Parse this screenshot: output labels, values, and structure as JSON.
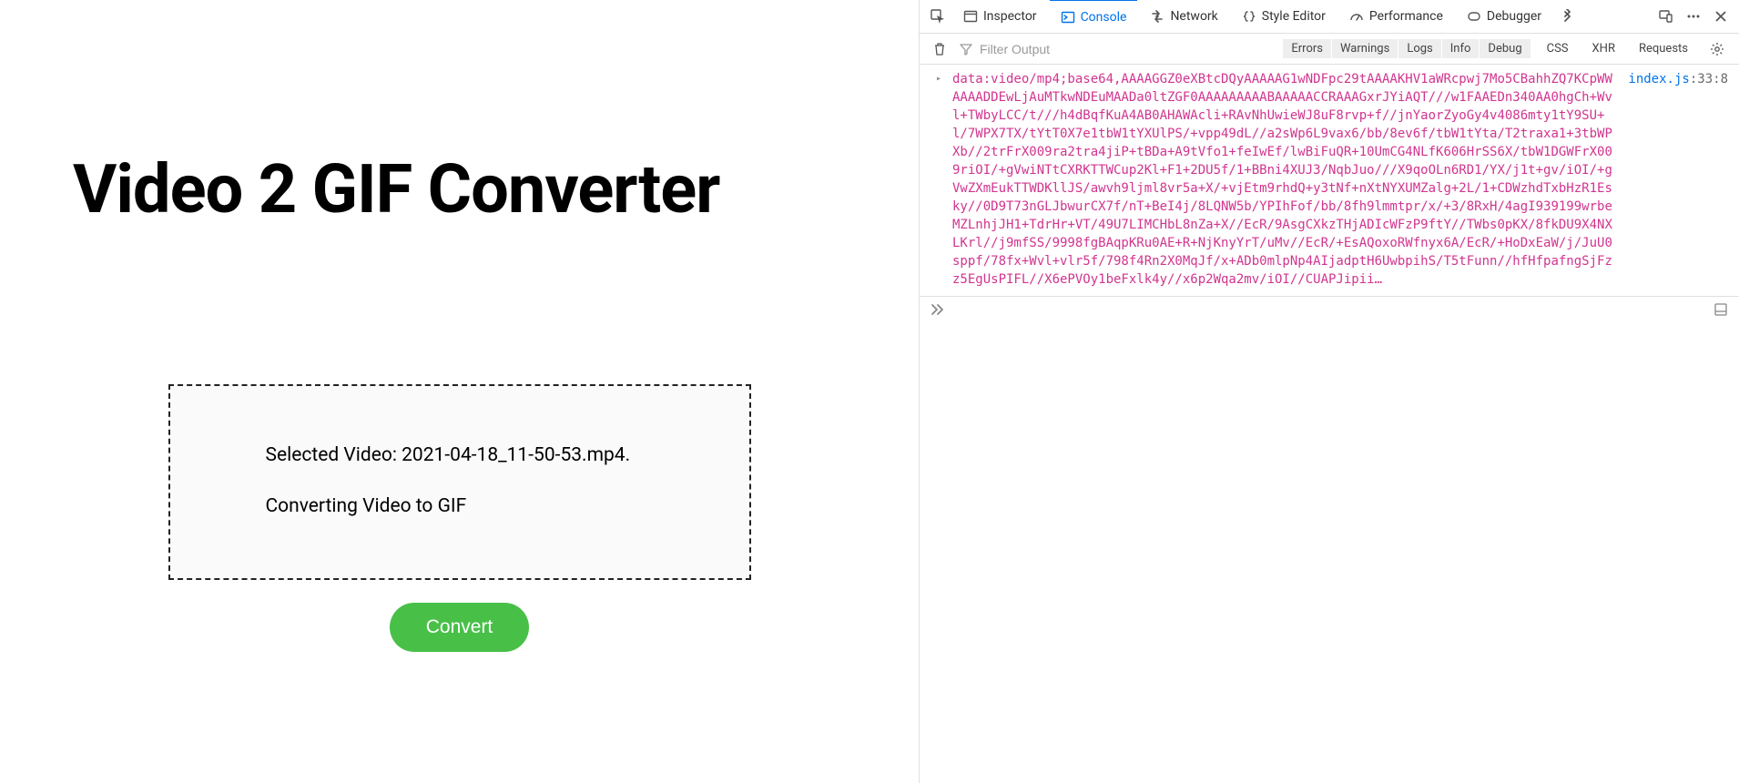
{
  "app": {
    "title": "Video 2 GIF Converter",
    "selected_label": "Selected Video: 2021-04-18_11-50-53.mp4.",
    "status_label": "Converting Video to GIF",
    "convert_label": "Convert"
  },
  "devtools": {
    "tabs": {
      "inspector": "Inspector",
      "console": "Console",
      "network": "Network",
      "style_editor": "Style Editor",
      "performance": "Performance",
      "debugger": "Debugger"
    },
    "filter_placeholder": "Filter Output",
    "levels": {
      "errors": "Errors",
      "warnings": "Warnings",
      "logs": "Logs",
      "info": "Info",
      "debug": "Debug"
    },
    "extra_filters": {
      "css": "CSS",
      "xhr": "XHR",
      "requests": "Requests"
    },
    "log": {
      "source_file": "index.js",
      "source_line": "33",
      "source_col": "8",
      "message": "data:video/mp4;base64,AAAAGGZ0eXBtcDQyAAAAAG1wNDFpc29tAAAAKHV1aWRcpwj7Mo5CBahhZQ7KCpWWAAAADDEwLjAuMTkwNDEuMAADa0ltZGF0AAAAAAAAABAAAAACCRAAAGxrJYiAQT///w1FAAEDn340AA0hgCh+Wvl+TWbyLCC/t///h4dBqfKuA4AB0AHAWAcli+RAvNhUwieWJ8uF8rvp+f//jnYaorZyoGy4v4086mty1tY9SU+l/7WPX7TX/tYtT0X7e1tbW1tYXUlPS/+vpp49dL//a2sWp6L9vax6/bb/8ev6f/tbW1tYta/T2traxa1+3tbWPXb//2trFrX009ra2tra4jiP+tBDa+A9tVfo1+feIwEf/lwBiFuQR+10UmCG4NLfK606HrSS6X/tbW1DGWFrX009riOI/+gVwiNTtCXRKTTWCup2Kl+F1+2DU5f/1+BBni4XUJ3/NqbJuo///X9qoOLn6RD1/YX/j1t+gv/iOI/+gVwZXmEukTTWDKllJS/awvh9ljml8vr5a+X/+vjEtm9rhdQ+y3tNf+nXtNYXUMZalg+2L/1+CDWzhdTxbHzR1Esky//0D9T73nGLJbwurCX7f/nT+BeI4j/8LQNW5b/YPIhFof/bb/8fh9lmmtpr/x/+3/8RxH/4agI939199wrbeMZLnhjJH1+TdrHr+VT/49U7LIMCHbL8nZa+X//EcR/9AsgCXkzTHjADIcWFzP9ftY//TWbs0pKX/8fkDU9X4NXLKrl//j9mfSS/9998fgBAqpKRu0AE+R+NjKnyYrT/uMv//EcR/+EsAQoxoRWfnyx6A/EcR/+HoDxEaW/j/JuU0sppf/78fx+Wvl+vlr5f/798f4Rn2X0MqJf/x+ADb0mlpNp4AIjadptH6UwbpihS/T5tFunn//hfHfpafngSjFzz5EgUsPIFL//X6ePVOy1beFxlk4y//x6p2Wqa2mv/iOI//CUAPJipii…"
    }
  }
}
